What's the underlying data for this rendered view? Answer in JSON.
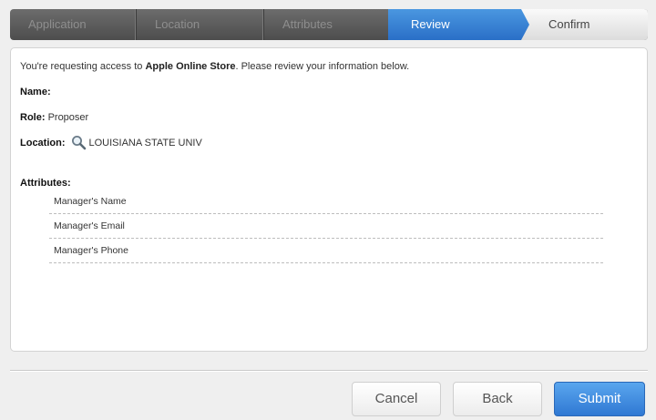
{
  "wizard": {
    "steps": [
      {
        "label": "Application",
        "state": "done"
      },
      {
        "label": "Location",
        "state": "done"
      },
      {
        "label": "Attributes",
        "state": "done"
      },
      {
        "label": "Review",
        "state": "active"
      },
      {
        "label": "Confirm",
        "state": "upcoming"
      }
    ]
  },
  "review": {
    "intro_prefix": "You're requesting access to ",
    "app_name": "Apple Online Store",
    "intro_suffix": ". Please review your information below.",
    "name_label": "Name:",
    "name_value": "",
    "role_label": "Role:",
    "role_value": "Proposer",
    "location_label": "Location:",
    "location_icon": "magnifier-icon",
    "location_value": "LOUISIANA STATE UNIV",
    "attributes_label": "Attributes:",
    "attributes": [
      "Manager's Name",
      "Manager's Email",
      "Manager's Phone"
    ]
  },
  "actions": {
    "cancel_label": "Cancel",
    "back_label": "Back",
    "submit_label": "Submit"
  },
  "colors": {
    "accent": "#2f78d3",
    "wizard_bar": "#5a5a5a"
  }
}
